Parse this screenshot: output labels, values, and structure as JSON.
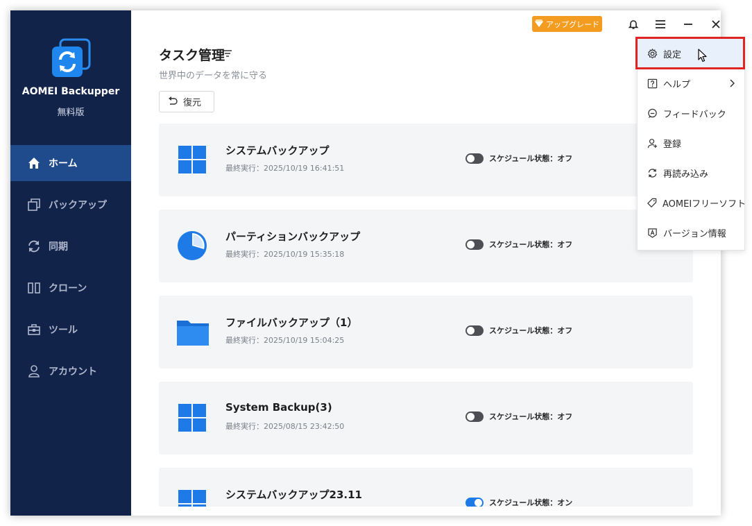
{
  "app": {
    "name": "AOMEI Backupper",
    "edition": "無料版"
  },
  "sidebar": {
    "items": [
      {
        "label": "ホーム",
        "icon": "home-icon",
        "active": true
      },
      {
        "label": "バックアップ",
        "icon": "backup-icon",
        "active": false
      },
      {
        "label": "同期",
        "icon": "sync-icon",
        "active": false
      },
      {
        "label": "クローン",
        "icon": "clone-icon",
        "active": false
      },
      {
        "label": "ツール",
        "icon": "tools-icon",
        "active": false
      },
      {
        "label": "アカウント",
        "icon": "account-icon",
        "active": false
      }
    ]
  },
  "topbar": {
    "upgrade_label": "アップグレード",
    "icons": [
      "bell-icon",
      "menu-icon",
      "minimize-icon",
      "close-icon"
    ]
  },
  "main": {
    "title": "タスク管理",
    "subtitle": "世界中のデータを常に守る",
    "restore_label": "復元"
  },
  "tasks": [
    {
      "name": "システムバックアップ",
      "last_run": "最終実行：2025/10/19 16:41:51",
      "icon": "windows-icon",
      "schedule": "スケジュール状態：オフ",
      "schedule_on": false
    },
    {
      "name": "パーティションバックアップ",
      "last_run": "最終実行：2025/10/19 15:35:18",
      "icon": "partition-pie-icon",
      "schedule": "スケジュール状態：オフ",
      "schedule_on": false
    },
    {
      "name": "ファイルバックアップ（1）",
      "last_run": "最終実行：2025/10/19 15:04:25",
      "icon": "folder-icon",
      "schedule": "スケジュール状態：オフ",
      "schedule_on": false
    },
    {
      "name": "System Backup(3)",
      "last_run": "最終実行：2025/08/15 23:42:50",
      "icon": "windows-icon",
      "schedule": "スケジュール状態：オフ",
      "schedule_on": false
    },
    {
      "name": "システムバックアップ23.11",
      "last_run": "",
      "icon": "windows-icon",
      "schedule": "スケジュール状態：オン",
      "schedule_on": true
    }
  ],
  "menu": {
    "items": [
      {
        "label": "設定",
        "icon": "gear-icon",
        "highlighted": true
      },
      {
        "label": "ヘルプ",
        "icon": "help-icon",
        "submenu": true
      },
      {
        "label": "フィードバック",
        "icon": "feedback-icon"
      },
      {
        "label": "登録",
        "icon": "register-icon"
      },
      {
        "label": "再読み込み",
        "icon": "reload-icon"
      },
      {
        "label": "AOMEIフリーソフト",
        "icon": "tag-icon"
      },
      {
        "label": "バージョン情報",
        "icon": "about-icon"
      }
    ]
  },
  "colors": {
    "sidebar_bg": "#12234a",
    "sidebar_active": "#1f4a8c",
    "accent_blue": "#1e7ae6",
    "upgrade_orange": "#f39c1f",
    "highlight_red": "#e02424"
  }
}
